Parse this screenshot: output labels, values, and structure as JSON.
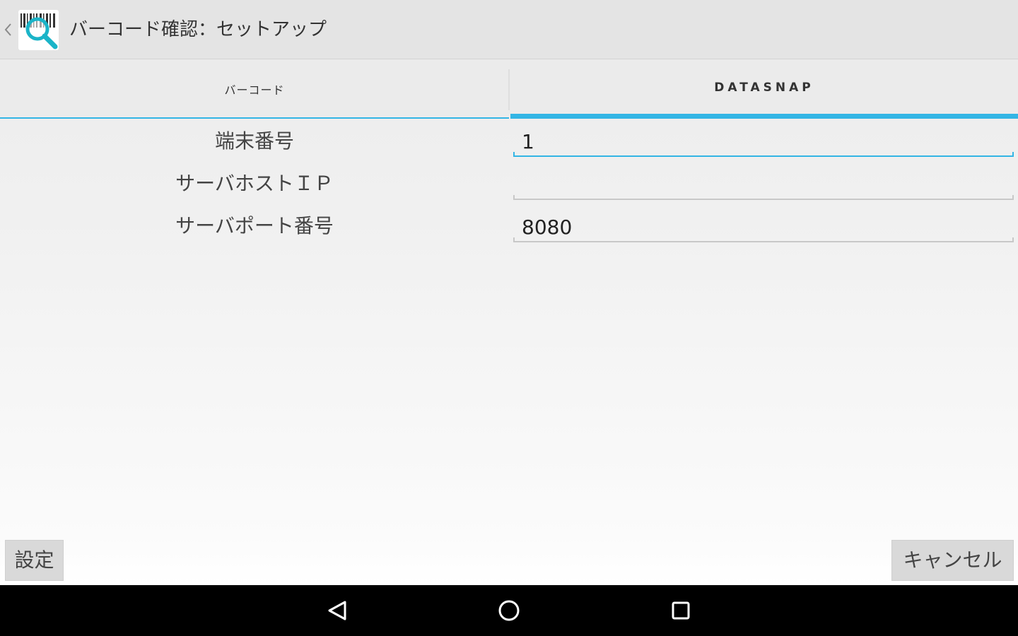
{
  "actionbar": {
    "title": "バーコード確認：セットアップ",
    "app_icon": "barcode-magnifier-icon",
    "up_icon": "chevron-left-icon"
  },
  "tabs": [
    {
      "label": "バーコード",
      "selected": false
    },
    {
      "label": "DATASNAP",
      "selected": true
    }
  ],
  "form": {
    "rows": [
      {
        "label": "端末番号",
        "value": "1",
        "focused": true
      },
      {
        "label": "サーバホストＩＰ",
        "value": "",
        "focused": false
      },
      {
        "label": "サーバポート番号",
        "value": "8080",
        "focused": false
      }
    ]
  },
  "buttons": {
    "settings_label": "設定",
    "cancel_label": "キャンセル"
  },
  "navbar": {
    "back_icon": "back-triangle-icon",
    "home_icon": "home-circle-icon",
    "recent_icon": "recent-apps-square-icon"
  },
  "colors": {
    "accent": "#33b5e5",
    "actionbar_bg": "#e4e4e4",
    "navbar_bg": "#000000"
  }
}
